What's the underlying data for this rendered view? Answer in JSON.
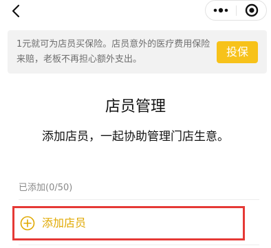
{
  "nav": {
    "back_icon": "chevron-left-icon",
    "more_icon": "more-dots-icon",
    "close_icon": "target-close-icon"
  },
  "banner": {
    "text": "1元就可为店员买保险。店员意外的医疗费用保险来赔，老板不再担心额外支出。",
    "button_label": "投保"
  },
  "main": {
    "title": "店员管理",
    "subtitle": "添加店员，一起协助管理门店生意。",
    "added_count": "已添加(0/50)",
    "add_label": "添加店员",
    "add_icon": "plus-circle-icon"
  },
  "colors": {
    "accent": "#f7c21a",
    "add_text": "#e0a800",
    "highlight_border": "#e53935",
    "banner_bg": "#f2f2f2"
  }
}
